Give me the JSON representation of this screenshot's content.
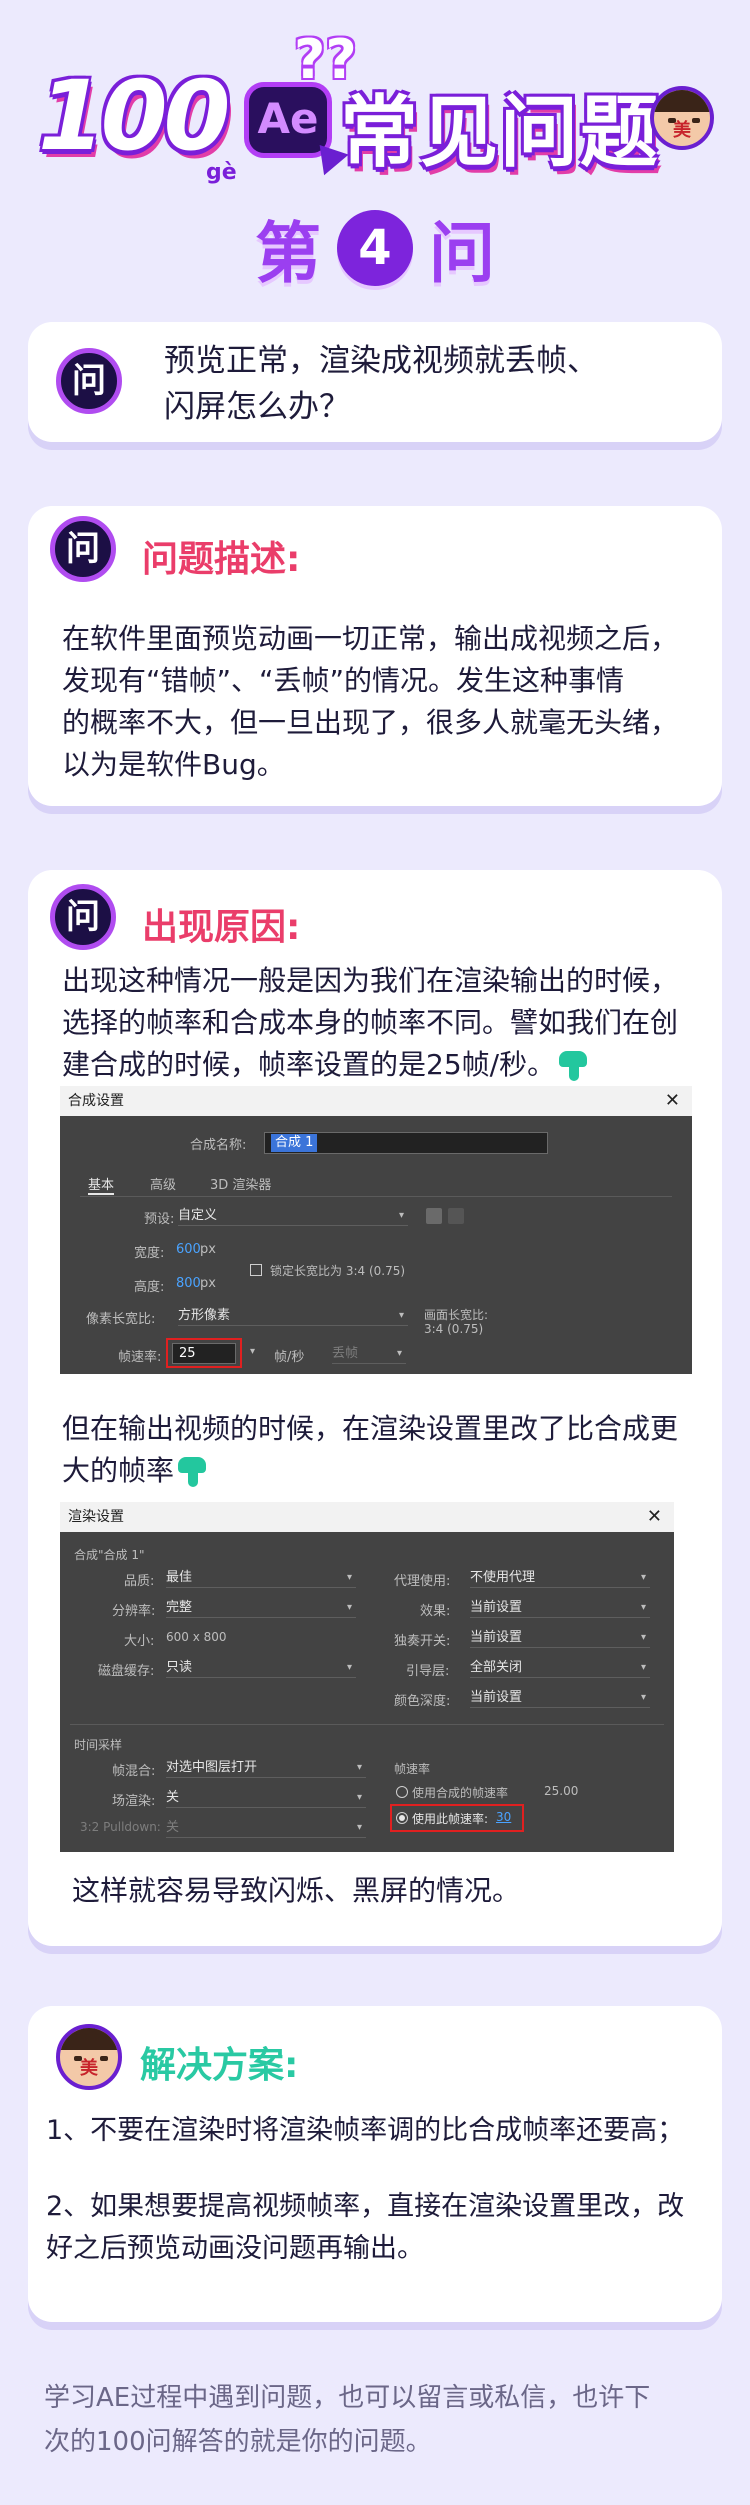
{
  "header": {
    "num": "100",
    "ge": "gè",
    "ae": "Ae",
    "q": "??",
    "title": "常见问题",
    "avatar_symbol": "美"
  },
  "subtitle": {
    "pre": "第",
    "num": "4",
    "post": "问"
  },
  "question": {
    "badge": "问",
    "text_l1": "预览正常，渲染成视频就丢帧、",
    "text_l2": "闪屏怎么办？"
  },
  "desc": {
    "badge": "问",
    "title": "问题描述:",
    "l1": "在软件里面预览动画一切正常，输出成视频之后，",
    "l2": "发现有“错帧”、“丢帧”的情况。发生这种事情",
    "l3": "的概率不大，但一旦出现了，很多人就毫无头绪，",
    "l4": "以为是软件Bug。"
  },
  "cause": {
    "badge": "问",
    "title": "出现原因:",
    "l1": "出现这种情况一般是因为我们在渲染输出的时候，",
    "l2": "选择的帧率和合成本身的帧率不同。譬如我们在创",
    "l3": "建合成的时候，帧率设置的是25帧/秒。",
    "l4": "但在输出视频的时候，在渲染设置里改了比合成更",
    "l5": "大的帧率",
    "l6": "这样就容易导致闪烁、黑屏的情况。"
  },
  "comp_dialog": {
    "title": "合成设置",
    "close": "✕",
    "name_label": "合成名称:",
    "name_value": "合成 1",
    "tab_basic": "基本",
    "tab_adv": "高级",
    "tab_3d": "3D 渲染器",
    "preset_label": "预设:",
    "preset_value": "自定义",
    "width_label": "宽度:",
    "width_value": "600",
    "px1": "px",
    "height_label": "高度:",
    "height_value": "800",
    "px2": "px",
    "lock_label": "锁定长宽比为 3:4 (0.75)",
    "par_label": "像素长宽比:",
    "par_value": "方形像素",
    "frame_ratio_label": "画面长宽比:",
    "frame_ratio_value": "3:4 (0.75)",
    "fps_label": "帧速率:",
    "fps_value": "25",
    "fps_unit": "帧/秒",
    "drop_value": "丢帧"
  },
  "render_dialog": {
    "title": "渲染设置",
    "close": "✕",
    "comp_name": "合成\"合成 1\"",
    "quality_label": "品质:",
    "quality_value": "最佳",
    "resolution_label": "分辨率:",
    "resolution_value": "完整",
    "size_label": "大小:",
    "size_value": "600 x 800",
    "cache_label": "磁盘缓存:",
    "cache_value": "只读",
    "proxy_label": "代理使用:",
    "proxy_value": "不使用代理",
    "effects_label": "效果:",
    "effects_value": "当前设置",
    "solo_label": "独奏开关:",
    "solo_value": "当前设置",
    "guide_label": "引导层:",
    "guide_value": "全部关闭",
    "depth_label": "颜色深度:",
    "depth_value": "当前设置",
    "time_section": "时间采样",
    "blend_label": "帧混合:",
    "blend_value": "对选中图层打开",
    "field_label": "场渲染:",
    "field_value": "关",
    "pulldown_label": "3:2 Pulldown:",
    "pulldown_value": "关",
    "fps_section": "帧速率",
    "use_comp": "使用合成的帧速率",
    "use_comp_val": "25.00",
    "use_this": "使用此帧速率:",
    "use_this_val": "30"
  },
  "solution": {
    "avatar_symbol": "美",
    "title": "解决方案:",
    "s1": "1、不要在渲染时将渲染帧率调的比合成帧率还要高；",
    "s2_l1": "2、如果想要提高视频帧率，直接在渲染设置里改，改",
    "s2_l2": "好之后预览动画没问题再输出。"
  },
  "footer": {
    "l1": "学习AE过程中遇到问题，也可以留言或私信，也许下",
    "l2": "次的100问解答的就是你的问题。"
  }
}
